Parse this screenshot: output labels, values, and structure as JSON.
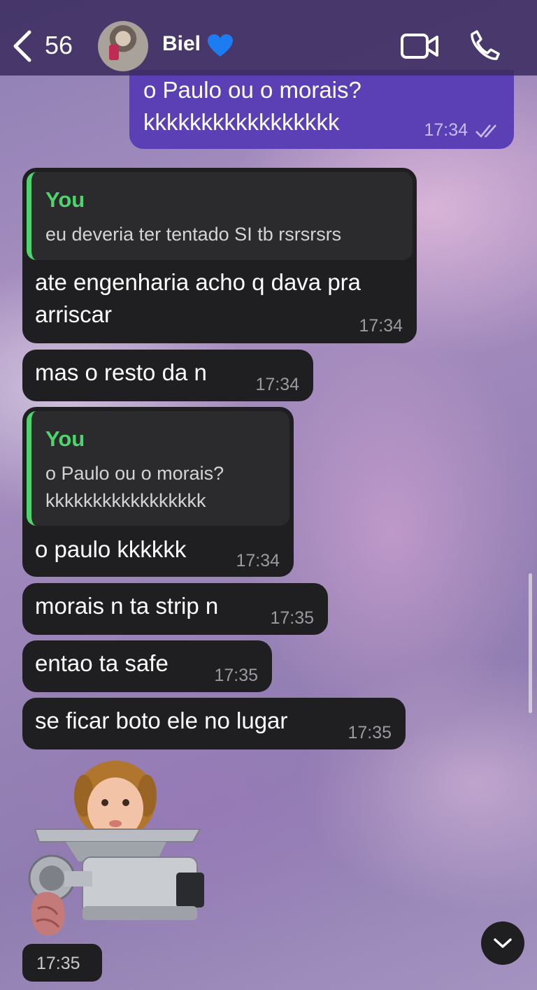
{
  "header": {
    "back_count": "56",
    "contact_name": "Biel",
    "heart_color": "#1e7cf2"
  },
  "messages": [
    {
      "direction": "outgoing",
      "text_lines": [
        "o Paulo ou o morais?",
        "kkkkkkkkkkkkkkkkk"
      ],
      "time": "17:34",
      "status": "read-double-check"
    },
    {
      "direction": "incoming",
      "reply_to": {
        "author": "You",
        "text_lines": [
          "eu deveria ter tentado SI tb rsrsrsrs"
        ]
      },
      "text_lines": [
        "ate engenharia acho q dava pra",
        "arriscar"
      ],
      "time": "17:34"
    },
    {
      "direction": "incoming",
      "text_lines": [
        "mas o resto da n"
      ],
      "time": "17:34"
    },
    {
      "direction": "incoming",
      "reply_to": {
        "author": "You",
        "text_lines": [
          "o Paulo ou o morais?",
          "kkkkkkkkkkkkkkkkk"
        ]
      },
      "text_lines": [
        "o paulo kkkkkk"
      ],
      "time": "17:34"
    },
    {
      "direction": "incoming",
      "text_lines": [
        "morais n ta strip n"
      ],
      "time": "17:35"
    },
    {
      "direction": "incoming",
      "text_lines": [
        "entao ta safe"
      ],
      "time": "17:35"
    },
    {
      "direction": "incoming",
      "text_lines": [
        "se ficar boto ele no lugar"
      ],
      "time": "17:35"
    },
    {
      "direction": "incoming",
      "type": "sticker",
      "sticker": "baby-in-meat-grinder",
      "time": "17:35"
    }
  ],
  "colors": {
    "outgoing_bubble": "#5a3fb5",
    "incoming_bubble": "#1f1f22",
    "quote_accent": "#4fd46d"
  }
}
